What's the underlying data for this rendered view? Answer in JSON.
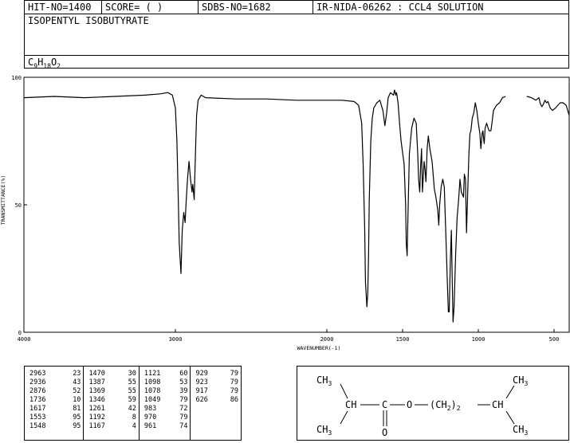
{
  "header": {
    "hit_no": "HIT-NO=1400",
    "score": "SCORE=  (  )",
    "sdbs_no": "SDBS-NO=1682",
    "ir_info": "IR-NIDA-06262 : CCL4 SOLUTION"
  },
  "compound": {
    "name": "ISOPENTYL ISOBUTYRATE",
    "formula_parts": [
      "C",
      "9",
      "H",
      "18",
      "O",
      "2"
    ]
  },
  "chart_data": {
    "type": "line",
    "xlabel": "WAVENUMBER(-1)",
    "ylabel": "TRANSMITTANCE(%)",
    "xlim": [
      4000,
      400
    ],
    "ylim": [
      0,
      100
    ],
    "x_ticks": [
      4000,
      3000,
      2000,
      1500,
      1000,
      500
    ],
    "x_tick_labels": [
      "4000",
      "3000",
      "2000",
      "1500",
      "1000",
      "500"
    ],
    "y_ticks": [
      0,
      50,
      100
    ],
    "y_tick_labels": [
      "0",
      "50",
      "100"
    ],
    "grid": false,
    "series": [
      {
        "segments": [
          [
            [
              4000,
              92
            ],
            [
              3800,
              92.5
            ],
            [
              3600,
              92
            ],
            [
              3400,
              92.5
            ],
            [
              3200,
              93
            ],
            [
              3100,
              93.5
            ],
            [
              3050,
              94
            ],
            [
              3020,
              93
            ],
            [
              3000,
              88
            ],
            [
              2990,
              75
            ],
            [
              2980,
              50
            ],
            [
              2975,
              35
            ],
            [
              2963,
              23
            ],
            [
              2955,
              40
            ],
            [
              2945,
              47
            ],
            [
              2936,
              43
            ],
            [
              2930,
              50
            ],
            [
              2920,
              60
            ],
            [
              2910,
              67
            ],
            [
              2900,
              60
            ],
            [
              2890,
              55
            ],
            [
              2885,
              58
            ],
            [
              2876,
              52
            ],
            [
              2870,
              65
            ],
            [
              2860,
              85
            ],
            [
              2850,
              91
            ],
            [
              2830,
              93
            ],
            [
              2800,
              92
            ],
            [
              2600,
              91.5
            ],
            [
              2400,
              91.5
            ],
            [
              2200,
              91
            ],
            [
              2000,
              91
            ],
            [
              1900,
              91
            ],
            [
              1820,
              90.5
            ],
            [
              1790,
              89
            ],
            [
              1770,
              82
            ],
            [
              1760,
              65
            ],
            [
              1750,
              40
            ],
            [
              1745,
              20
            ],
            [
              1736,
              10
            ],
            [
              1730,
              15
            ],
            [
              1725,
              30
            ],
            [
              1720,
              52
            ],
            [
              1710,
              75
            ],
            [
              1700,
              84
            ],
            [
              1690,
              88
            ],
            [
              1670,
              90
            ],
            [
              1650,
              91
            ],
            [
              1630,
              87
            ],
            [
              1617,
              81
            ],
            [
              1605,
              86
            ],
            [
              1595,
              92
            ],
            [
              1580,
              94
            ],
            [
              1560,
              93
            ],
            [
              1553,
              95
            ],
            [
              1545,
              93
            ],
            [
              1540,
              94
            ],
            [
              1530,
              90
            ],
            [
              1520,
              82
            ],
            [
              1510,
              75
            ],
            [
              1490,
              66
            ],
            [
              1480,
              50
            ],
            [
              1476,
              35
            ],
            [
              1470,
              30
            ],
            [
              1465,
              45
            ],
            [
              1455,
              70
            ],
            [
              1440,
              80
            ],
            [
              1425,
              84
            ],
            [
              1410,
              82
            ],
            [
              1400,
              70
            ],
            [
              1394,
              60
            ],
            [
              1387,
              55
            ],
            [
              1381,
              65
            ],
            [
              1375,
              72
            ],
            [
              1369,
              55
            ],
            [
              1364,
              60
            ],
            [
              1358,
              67
            ],
            [
              1352,
              64
            ],
            [
              1346,
              59
            ],
            [
              1338,
              72
            ],
            [
              1330,
              77
            ],
            [
              1320,
              72
            ],
            [
              1305,
              67
            ],
            [
              1290,
              56
            ],
            [
              1280,
              53
            ],
            [
              1268,
              48
            ],
            [
              1261,
              42
            ],
            [
              1255,
              50
            ],
            [
              1245,
              57
            ],
            [
              1235,
              60
            ],
            [
              1225,
              57
            ],
            [
              1215,
              40
            ],
            [
              1205,
              20
            ],
            [
              1198,
              8
            ],
            [
              1192,
              8
            ],
            [
              1185,
              28
            ],
            [
              1178,
              40
            ],
            [
              1172,
              20
            ],
            [
              1167,
              4
            ],
            [
              1160,
              10
            ],
            [
              1150,
              30
            ],
            [
              1140,
              45
            ],
            [
              1130,
              52
            ],
            [
              1121,
              60
            ],
            [
              1112,
              55
            ],
            [
              1105,
              54
            ],
            [
              1098,
              53
            ],
            [
              1092,
              62
            ],
            [
              1085,
              60
            ],
            [
              1078,
              39
            ],
            [
              1070,
              55
            ],
            [
              1062,
              70
            ],
            [
              1055,
              78
            ],
            [
              1049,
              79
            ],
            [
              1040,
              84
            ],
            [
              1030,
              86
            ],
            [
              1020,
              90
            ],
            [
              1010,
              87
            ],
            [
              1000,
              82
            ],
            [
              990,
              78
            ],
            [
              983,
              72
            ],
            [
              975,
              78
            ],
            [
              970,
              79
            ],
            [
              965,
              76
            ],
            [
              961,
              74
            ],
            [
              955,
              80
            ],
            [
              945,
              82
            ],
            [
              935,
              80
            ],
            [
              929,
              79
            ],
            [
              923,
              79
            ],
            [
              917,
              79
            ],
            [
              910,
              82
            ],
            [
              900,
              87
            ],
            [
              880,
              89
            ],
            [
              860,
              90
            ],
            [
              840,
              92
            ],
            [
              820,
              92.5
            ]
          ],
          [
            [
              680,
              92.5
            ],
            [
              650,
              92
            ],
            [
              620,
              91
            ],
            [
              600,
              92
            ],
            [
              590,
              89.5
            ],
            [
              580,
              88.5
            ],
            [
              570,
              89.5
            ],
            [
              560,
              91
            ],
            [
              550,
              90
            ],
            [
              540,
              90.5
            ],
            [
              526,
              88
            ],
            [
              510,
              87
            ],
            [
              490,
              88
            ],
            [
              460,
              90
            ],
            [
              440,
              90
            ],
            [
              420,
              89
            ],
            [
              400,
              85
            ]
          ]
        ]
      }
    ]
  },
  "peak_table": [
    [
      [
        "2963",
        "23"
      ],
      [
        "2936",
        "43"
      ],
      [
        "2876",
        "52"
      ],
      [
        "1736",
        "10"
      ],
      [
        "1617",
        "81"
      ],
      [
        "1553",
        "95"
      ],
      [
        "1548",
        "95"
      ]
    ],
    [
      [
        "1470",
        "30"
      ],
      [
        "1387",
        "55"
      ],
      [
        "1369",
        "55"
      ],
      [
        "1346",
        "59"
      ],
      [
        "1261",
        "42"
      ],
      [
        "1192",
        "8"
      ],
      [
        "1167",
        "4"
      ]
    ],
    [
      [
        "1121",
        "60"
      ],
      [
        "1098",
        "53"
      ],
      [
        "1078",
        "39"
      ],
      [
        "1049",
        "79"
      ],
      [
        "983",
        "72"
      ],
      [
        "970",
        "79"
      ],
      [
        "961",
        "74"
      ]
    ],
    [
      [
        "929",
        "79"
      ],
      [
        "923",
        "79"
      ],
      [
        "917",
        "79"
      ],
      [
        "626",
        "86"
      ]
    ]
  ],
  "structure": {
    "ch3_top_left": "CH",
    "ch3_top_left_sub": "3",
    "ch3_bottom_left": "CH",
    "ch3_bottom_left_sub": "3",
    "ch_left": "CH",
    "c_center": "C",
    "o_ester": "O",
    "ch2_group": "(CH",
    "ch2_sub": "2",
    "ch2_close": ")",
    "ch2_count": "2",
    "ch_right": "CH",
    "ch3_top_right": "CH",
    "ch3_top_right_sub": "3",
    "ch3_bottom_right": "CH",
    "ch3_bottom_right_sub": "3",
    "o_carbonyl": "O"
  }
}
